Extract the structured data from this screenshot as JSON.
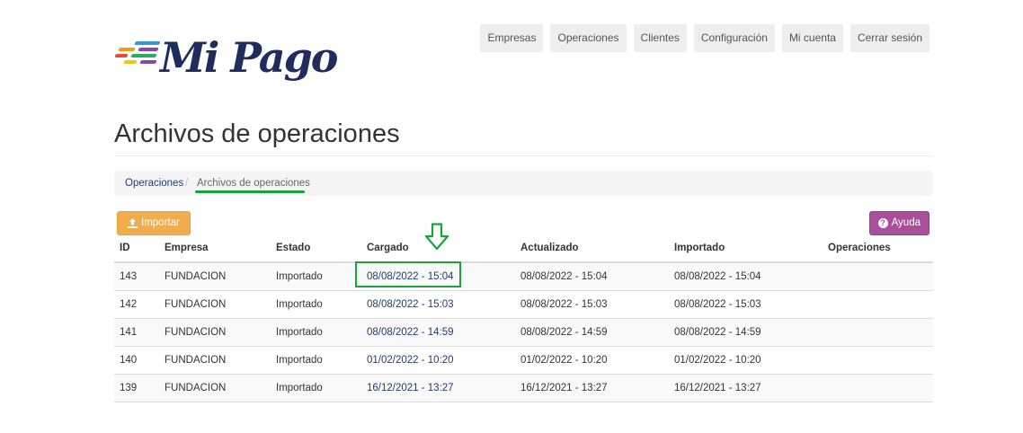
{
  "brand": {
    "logo_text": "Mi Pago",
    "stripe_colors": [
      "#f39c12",
      "#e74c3c",
      "#27ae60",
      "#3498db",
      "#8e44ad",
      "#f1c40f"
    ]
  },
  "topnav": {
    "items": [
      "Empresas",
      "Operaciones",
      "Clientes",
      "Configuración",
      "Mi cuenta",
      "Cerrar sesión"
    ]
  },
  "page": {
    "title": "Archivos de operaciones"
  },
  "breadcrumb": {
    "parent": "Operaciones",
    "separator": "/",
    "current": "Archivos de operaciones"
  },
  "actions": {
    "import_label": "Importar",
    "help_label": "Ayuda"
  },
  "table": {
    "columns": [
      "ID",
      "Empresa",
      "Estado",
      "Cargado",
      "Actualizado",
      "Importado",
      "Operaciones"
    ],
    "rows": [
      [
        "143",
        "FUNDACION",
        "Importado",
        "08/08/2022 - 15:04",
        "08/08/2022 - 15:04",
        "08/08/2022 - 15:04",
        ""
      ],
      [
        "142",
        "FUNDACION",
        "Importado",
        "08/08/2022 - 15:03",
        "08/08/2022 - 15:03",
        "08/08/2022 - 15:03",
        ""
      ],
      [
        "141",
        "FUNDACION",
        "Importado",
        "08/08/2022 - 14:59",
        "08/08/2022 - 14:59",
        "08/08/2022 - 14:59",
        ""
      ],
      [
        "140",
        "FUNDACION",
        "Importado",
        "01/02/2022 - 10:20",
        "01/02/2022 - 10:20",
        "01/02/2022 - 10:20",
        ""
      ],
      [
        "139",
        "FUNDACION",
        "Importado",
        "16/12/2021 - 13:27",
        "16/12/2021 - 13:27",
        "16/12/2021 - 13:27",
        ""
      ]
    ]
  },
  "colors": {
    "brand_navy": "#1f2c5c",
    "link": "#1f3c7a",
    "import_button": "#f0ad4e",
    "help_button": "#a94f9a",
    "annotation_green": "#1aa33b"
  }
}
